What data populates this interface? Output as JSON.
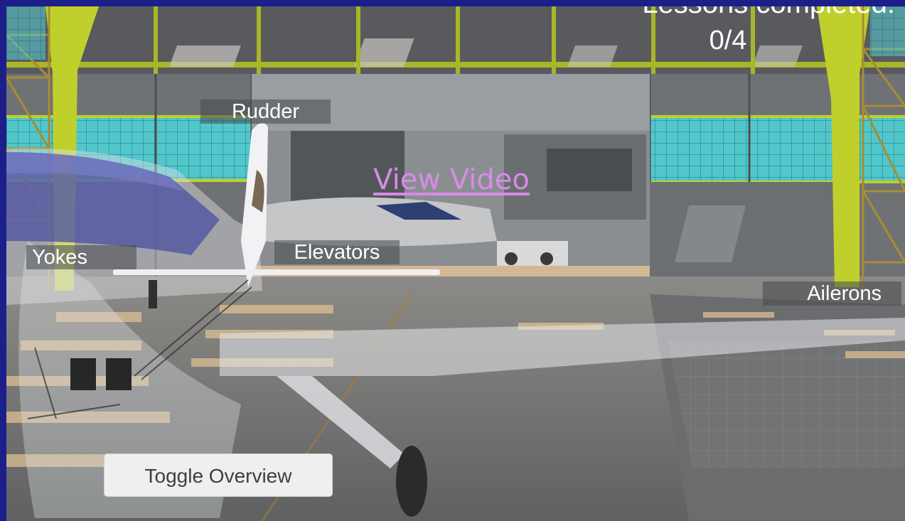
{
  "hud": {
    "lessons_completed_label": "Lessons completed:",
    "lessons_completed_value": "0/4",
    "view_video_link": "View Video"
  },
  "part_labels": {
    "rudder": "Rudder",
    "yokes": "Yokes",
    "elevators": "Elevators",
    "ailerons": "Ailerons"
  },
  "controls": {
    "toggle_overview": "Toggle Overview"
  },
  "colors": {
    "frame_border": "#1c1f8a",
    "hangar_frame": "#b7cd2a",
    "hangar_glass": "#4fc3c9",
    "link_color": "#d78be8",
    "label_background": "#46484c"
  }
}
